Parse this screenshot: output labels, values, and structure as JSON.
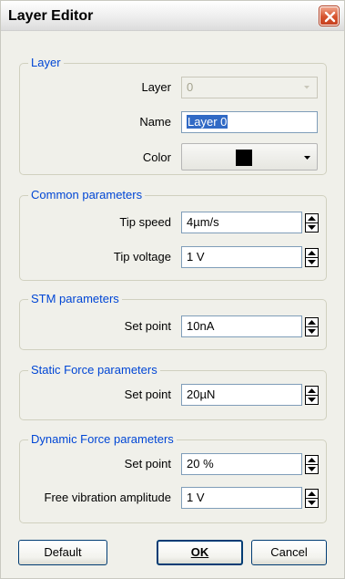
{
  "window": {
    "title": "Layer Editor"
  },
  "groups": {
    "layer": {
      "title": "Layer",
      "layer_label": "Layer",
      "layer_value": "0",
      "name_label": "Name",
      "name_value": "Layer 0",
      "color_label": "Color",
      "color_value": "#000000"
    },
    "common": {
      "title": "Common parameters",
      "tip_speed_label": "Tip speed",
      "tip_speed_value": "4µm/s",
      "tip_voltage_label": "Tip voltage",
      "tip_voltage_value": "1 V"
    },
    "stm": {
      "title": "STM parameters",
      "set_point_label": "Set point",
      "set_point_value": "10nA"
    },
    "static": {
      "title": "Static Force parameters",
      "set_point_label": "Set point",
      "set_point_value": "20µN"
    },
    "dynamic": {
      "title": "Dynamic Force parameters",
      "set_point_label": "Set point",
      "set_point_value": "20 %",
      "amplitude_label": "Free vibration amplitude",
      "amplitude_value": "1 V"
    }
  },
  "buttons": {
    "default_label": "Default",
    "ok_label": "OK",
    "cancel_label": "Cancel"
  },
  "colors": {
    "group_title": "#0046d5",
    "close_button": "#d6532e"
  },
  "icons": {
    "close": "close-x-icon",
    "dropdown": "chevron-down-icon",
    "spin": "spin-up-down-icon"
  }
}
